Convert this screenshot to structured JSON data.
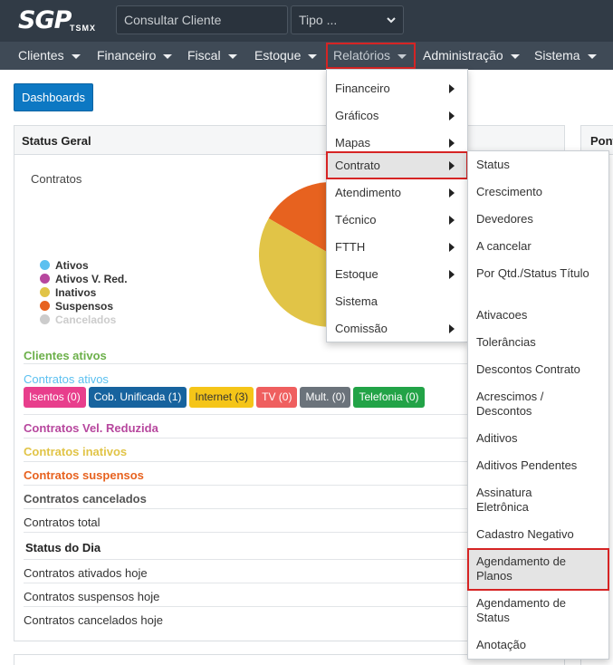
{
  "header": {
    "logo": "SGP",
    "logo_sub": "TSMX",
    "search_placeholder": "Consultar Cliente",
    "tipo_label": "Tipo ..."
  },
  "nav": {
    "items": [
      "Clientes",
      "Financeiro",
      "Fiscal",
      "Estoque",
      "Relatórios",
      "Administração",
      "Sistema"
    ],
    "active": "Relatórios"
  },
  "dashboards_button": "Dashboards",
  "status_geral": {
    "title": "Status Geral",
    "chart_title": "Contratos",
    "legend": [
      {
        "label": "Ativos",
        "color": "#5bc0f0"
      },
      {
        "label": "Ativos V. Red.",
        "color": "#b7479e"
      },
      {
        "label": "Inativos",
        "color": "#e1c447"
      },
      {
        "label": "Suspensos",
        "color": "#e7621f"
      },
      {
        "label": "Cancelados",
        "color": "#cccccc"
      }
    ],
    "clientes_ativos": "Clientes ativos",
    "contratos_ativos": "Contratos ativos",
    "badges": [
      {
        "label": "Isentos (0)",
        "color": "#e83e8c"
      },
      {
        "label": "Cob. Unificada (1)",
        "color": "#17639e"
      },
      {
        "label": "Internet (3)",
        "color": "#f5c518"
      },
      {
        "label": "TV (0)",
        "color": "#ef5f5f"
      },
      {
        "label": "Mult. (0)",
        "color": "#6b737b"
      },
      {
        "label": "Telefonia (0)",
        "color": "#22a347"
      }
    ],
    "rows": [
      {
        "label": "Contratos Vel. Reduzida",
        "color": "#b7479e",
        "bold": true
      },
      {
        "label": "Contratos inativos",
        "color": "#e1c447",
        "bold": true
      },
      {
        "label": "Contratos suspensos",
        "color": "#e7621f",
        "bold": true
      },
      {
        "label": "Contratos cancelados",
        "color": "#555555",
        "bold": true
      },
      {
        "label": "Contratos total",
        "color": "#333333",
        "bold": false
      }
    ],
    "status_dia_title": "Status do Dia",
    "status_dia": [
      "Contratos ativados hoje",
      "Contratos suspensos hoje",
      "Contratos cancelados hoje"
    ]
  },
  "right_panel": {
    "title": "Pont"
  },
  "menu_relatorios": [
    {
      "label": "Financeiro",
      "submenu": true
    },
    {
      "label": "Gráficos",
      "submenu": true
    },
    {
      "label": "Mapas",
      "submenu": true
    },
    {
      "label": "Contrato",
      "submenu": true,
      "active": true
    },
    {
      "label": "Atendimento",
      "submenu": true
    },
    {
      "label": "Técnico",
      "submenu": true
    },
    {
      "label": "FTTH",
      "submenu": true
    },
    {
      "label": "Estoque",
      "submenu": true
    },
    {
      "label": "Sistema",
      "submenu": false
    },
    {
      "label": "Comissão",
      "submenu": true
    }
  ],
  "menu_contrato": [
    {
      "label": "Status"
    },
    {
      "label": "Crescimento"
    },
    {
      "label": "Devedores"
    },
    {
      "label": "A cancelar"
    },
    {
      "label": "Por Qtd./Status Título"
    },
    {
      "label": "Ativacoes"
    },
    {
      "label": "Tolerâncias"
    },
    {
      "label": "Descontos Contrato"
    },
    {
      "label": "Acrescimos / Descontos"
    },
    {
      "label": "Aditivos"
    },
    {
      "label": "Aditivos Pendentes"
    },
    {
      "label": "Assinatura Eletrônica"
    },
    {
      "label": "Cadastro Negativo"
    },
    {
      "label": "Agendamento de Planos",
      "active": true
    },
    {
      "label": "Agendamento de Status"
    },
    {
      "label": "Anotação"
    }
  ]
}
